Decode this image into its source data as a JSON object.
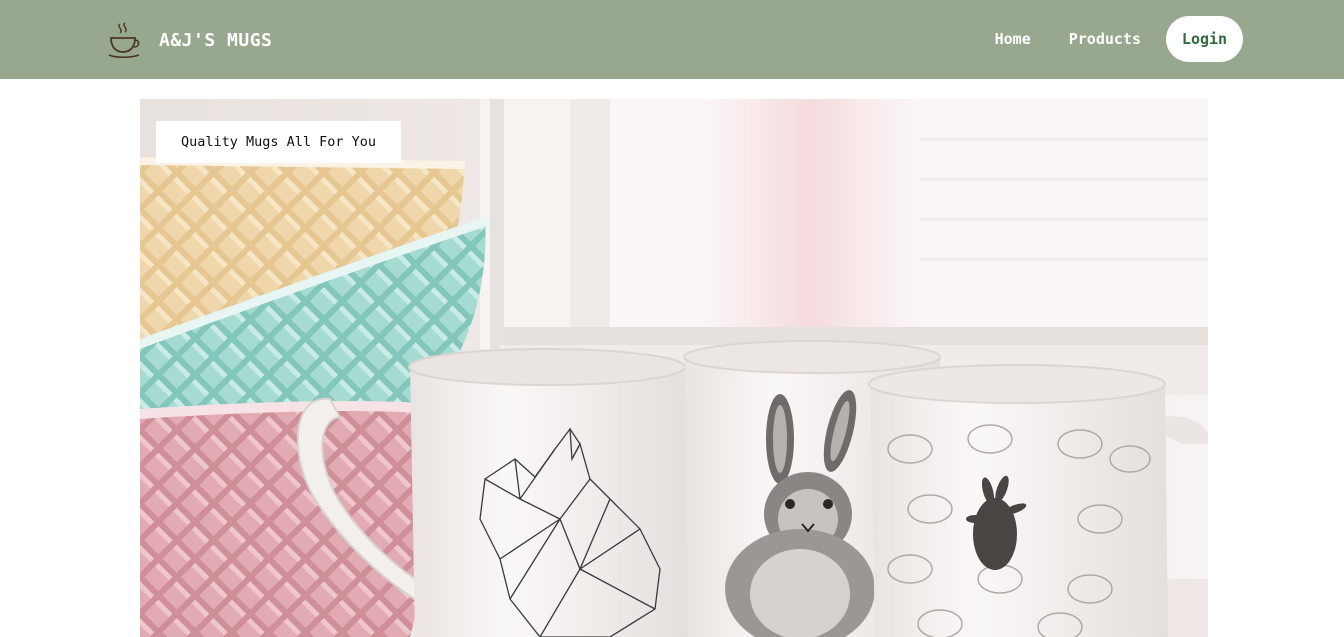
{
  "header": {
    "brand": "A&J'S MUGS",
    "logo_icon": "coffee-cup-icon",
    "nav": {
      "home": "Home",
      "products": "Products",
      "login": "Login"
    }
  },
  "hero": {
    "tagline": "Quality Mugs All For You",
    "image": "stacked-bowls-and-rabbit-mugs-photo"
  },
  "colors": {
    "navbar_bg": "#98a88e",
    "login_text": "#2f6b3c"
  }
}
